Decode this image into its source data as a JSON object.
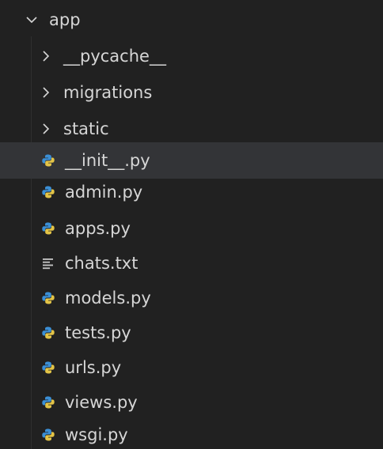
{
  "colors": {
    "background": "#212121",
    "selected_row": "#333437",
    "text": "#d6d6d6",
    "python_icon_blue": "#3b8fd6",
    "python_icon_yellow": "#e3c447",
    "text_icon": "#c8c8c8"
  },
  "explorer": {
    "root": {
      "label": "app",
      "expanded": true,
      "icon": "chevron-down-icon"
    },
    "folders": [
      {
        "label": "__pycache__",
        "icon": "chevron-right-icon"
      },
      {
        "label": "migrations",
        "icon": "chevron-right-icon"
      },
      {
        "label": "static",
        "icon": "chevron-right-icon"
      }
    ],
    "files": [
      {
        "label": "__init__.py",
        "icon": "python-file-icon",
        "selected": true
      },
      {
        "label": "admin.py",
        "icon": "python-file-icon"
      },
      {
        "label": "apps.py",
        "icon": "python-file-icon"
      },
      {
        "label": "chats.txt",
        "icon": "text-file-icon"
      },
      {
        "label": "models.py",
        "icon": "python-file-icon"
      },
      {
        "label": "tests.py",
        "icon": "python-file-icon"
      },
      {
        "label": "urls.py",
        "icon": "python-file-icon"
      },
      {
        "label": "views.py",
        "icon": "python-file-icon"
      },
      {
        "label": "wsgi.py",
        "icon": "python-file-icon"
      }
    ]
  }
}
